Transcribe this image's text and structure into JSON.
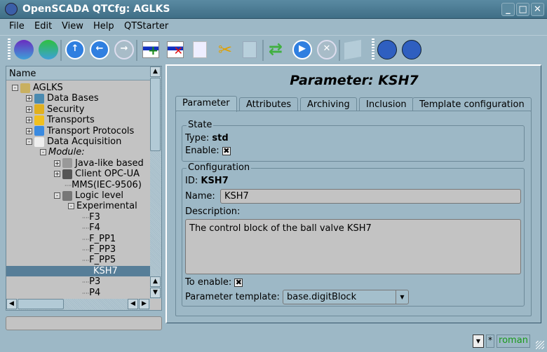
{
  "window": {
    "title": "OpenSCADA QTCfg: AGLKS",
    "minimize": "_",
    "maximize": "□",
    "close": "✕"
  },
  "menu": [
    "File",
    "Edit",
    "View",
    "Help",
    "QTStarter"
  ],
  "toolbar": [
    "db-load-icon",
    "db-save-icon",
    "up-icon",
    "back-icon",
    "forward-icon",
    "add-item-icon",
    "delete-item-icon",
    "copy-icon",
    "cut-icon",
    "paste-icon",
    "refresh-icon",
    "start-icon",
    "stop-icon",
    "info-icon",
    "qtcfg-icon",
    "visual-editor-icon"
  ],
  "tree": {
    "header": "Name",
    "items": [
      {
        "label": "AGLKS",
        "exp": "-"
      },
      {
        "label": "Data Bases",
        "exp": "+"
      },
      {
        "label": "Security",
        "exp": "+"
      },
      {
        "label": "Transports",
        "exp": "+"
      },
      {
        "label": "Transport Protocols",
        "exp": "+"
      },
      {
        "label": "Data Acquisition",
        "exp": "-"
      },
      {
        "label": "Module:",
        "exp": "-"
      },
      {
        "label": "Java-like based",
        "exp": "+"
      },
      {
        "label": "Client OPC-UA",
        "exp": "+"
      },
      {
        "label": "MMS(IEC-9506)",
        "exp": ""
      },
      {
        "label": "Logic level",
        "exp": "-"
      },
      {
        "label": "Experimental",
        "exp": "-"
      },
      {
        "label": "F3",
        "exp": ""
      },
      {
        "label": "F4",
        "exp": ""
      },
      {
        "label": "F_PP1",
        "exp": ""
      },
      {
        "label": "F_PP3",
        "exp": ""
      },
      {
        "label": "F_PP5",
        "exp": ""
      },
      {
        "label": "KSH7",
        "exp": "",
        "selected": true
      },
      {
        "label": "P3",
        "exp": ""
      },
      {
        "label": "P4",
        "exp": ""
      }
    ]
  },
  "page": {
    "title": "Parameter: KSH7",
    "tabs": [
      "Parameter",
      "Attributes",
      "Archiving",
      "Inclusion",
      "Template configuration"
    ],
    "state": {
      "legend": "State",
      "type_label": "Type:",
      "type_value": "std",
      "enable_label": "Enable:",
      "enable_check": "✖"
    },
    "config": {
      "legend": "Configuration",
      "id_label": "ID:",
      "id_value": "KSH7",
      "name_label": "Name:",
      "name_value": "KSH7",
      "desc_label": "Description:",
      "desc_value": "The control block of the ball valve KSH7",
      "toenable_label": "To enable:",
      "toenable_check": "✖",
      "template_label": "Parameter template:",
      "template_value": "base.digitBlock"
    }
  },
  "status": {
    "star": "*",
    "user": "roman",
    "user_color": "#1a9a1a"
  },
  "colors": {
    "selection": "#577e98",
    "background": "#9db8c6"
  }
}
